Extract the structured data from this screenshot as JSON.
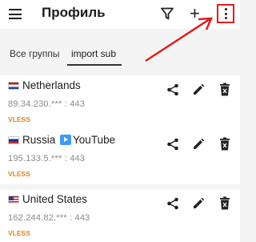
{
  "appbar": {
    "title": "Профиль"
  },
  "tabs": [
    {
      "label": "Все группы"
    },
    {
      "label": "import sub"
    }
  ],
  "profiles": [
    {
      "name": "Netherlands",
      "flag": "flag-nl",
      "address": "89.34.230.*** : 443",
      "protocol": "VLESS"
    },
    {
      "name_prefix": "Russia",
      "name_suffix": "YouTube",
      "flag": "flag-ru",
      "address": "195.133.5.*** : 443",
      "protocol": "VLESS"
    },
    {
      "name": "United States",
      "flag": "flag-us",
      "address": "162.244.82.*** : 443",
      "protocol": "VLESS"
    }
  ],
  "colors": {
    "accent_protocol": "#e2831b",
    "highlight_box": "#e21d1d"
  }
}
